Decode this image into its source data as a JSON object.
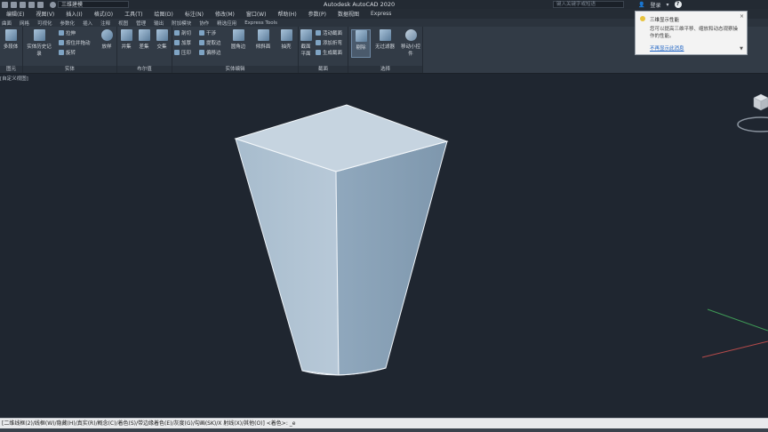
{
  "title_bar": {
    "workspace": "三维建模",
    "app_title": "Autodesk AutoCAD 2020",
    "search_placeholder": "键入关键字或短语",
    "login": "登录"
  },
  "menu": [
    "编辑(E)",
    "视图(V)",
    "插入(I)",
    "格式(O)",
    "工具(T)",
    "绘图(D)",
    "标注(N)",
    "修改(M)",
    "窗口(W)",
    "帮助(H)",
    "参数(P)",
    "数据视图",
    "Express"
  ],
  "ribbon_tabs": [
    "曲面",
    "网格",
    "可视化",
    "参数化",
    "插入",
    "注释",
    "视图",
    "管理",
    "输出",
    "附加模块",
    "协作",
    "精选应用",
    "Express Tools"
  ],
  "ribbon": {
    "panels": [
      "图元",
      "实体",
      "布尔值",
      "实体编辑",
      "截面",
      "选择"
    ],
    "buttons": {
      "polysolid": "多段体",
      "history": "实体历史记录",
      "extrude": "拉伸",
      "presspull": "按住并拖动",
      "revolve": "旋转",
      "loft": "放样",
      "union": "并集",
      "subtract": "差集",
      "intersect": "交集",
      "slice": "剖切",
      "thicken": "加厚",
      "imprint": "压印",
      "interfere": "干涉",
      "extract_edges": "提取边",
      "offset_edge": "偏移边",
      "fillet": "圆角边",
      "shell": "倾斜面",
      "extract": "抽壳",
      "section_plane": "截面平面",
      "live_section": "活动截面",
      "add_jog": "添加折弯",
      "generate_section": "生成截面",
      "culling": "剔除",
      "no_filter": "无过滤器",
      "gizmo": "移动小控件"
    }
  },
  "tooltip": {
    "title": "三维显示性能",
    "body": "您可以提高三维平移、缩放和动态观察操作的性能。",
    "link": "不再显示此消息"
  },
  "viewport_label": "[自定义视图]",
  "command_line": "[二维线框(2)/线框(W)/隐藏(H)/真实(R)/概念(C)/着色(S)/带边缘着色(E)/灰度(G)/勾画(SK)/X 射线(X)/其他(O)] <着色>: _e",
  "colors": {
    "background": "#1f2630",
    "solid_light": "#b9c9d8",
    "solid_mid": "#9fb2c4",
    "solid_dark": "#86a0b6",
    "edge": "#f2f6fa"
  }
}
